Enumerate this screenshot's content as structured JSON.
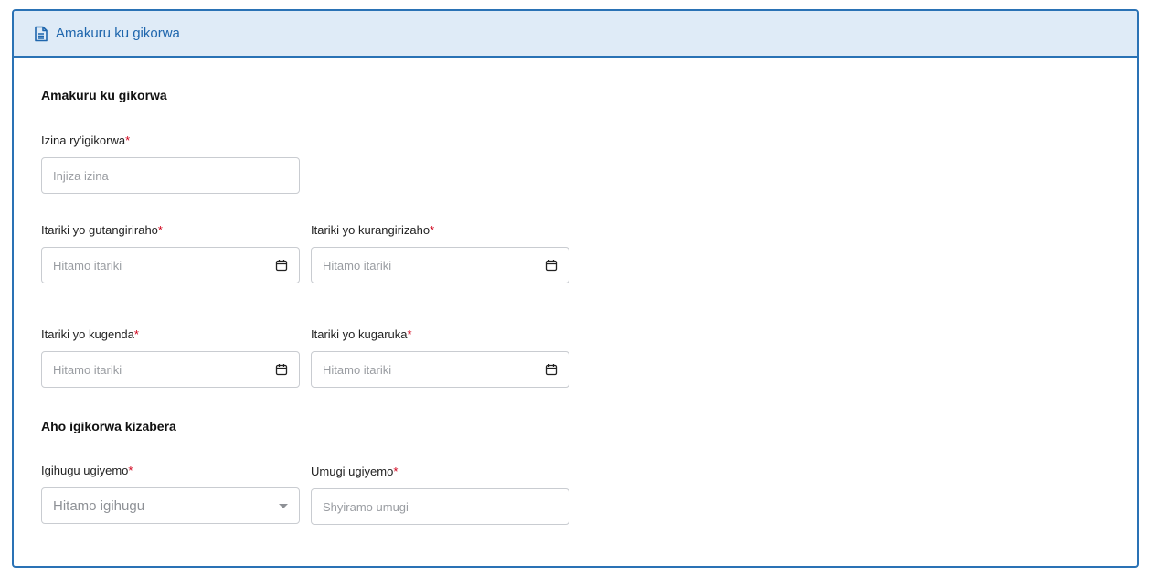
{
  "header": {
    "title": "Amakuru ku gikorwa",
    "icon": "document-icon",
    "accent": "#2a72b5",
    "background": "#dfebf7"
  },
  "sections": {
    "event_info": "Amakuru ku gikorwa",
    "location": "Aho igikorwa kizabera"
  },
  "fields": {
    "event_name": {
      "label": "Izina ry'igikorwa",
      "required_mark": "*",
      "placeholder": "Injiza izina"
    },
    "registration_start": {
      "label": "Itariki yo gutangiriraho",
      "required_mark": "*",
      "placeholder": "Hitamo itariki",
      "icon": "calendar-icon"
    },
    "registration_end": {
      "label": "Itariki yo kurangirizaho",
      "required_mark": "*",
      "placeholder": "Hitamo itariki",
      "icon": "calendar-icon"
    },
    "departure_date": {
      "label": "Itariki yo kugenda",
      "required_mark": "*",
      "placeholder": "Hitamo itariki",
      "icon": "calendar-icon"
    },
    "return_date": {
      "label": "Itariki yo kugaruka",
      "required_mark": "*",
      "placeholder": "Hitamo itariki",
      "icon": "calendar-icon"
    },
    "country": {
      "label": "Igihugu ugiyemo",
      "required_mark": "*",
      "placeholder": "Hitamo igihugu",
      "icon": "chevron-down-icon"
    },
    "city": {
      "label": "Umugi ugiyemo",
      "required_mark": "*",
      "placeholder": "Shyiramo umugi"
    }
  }
}
